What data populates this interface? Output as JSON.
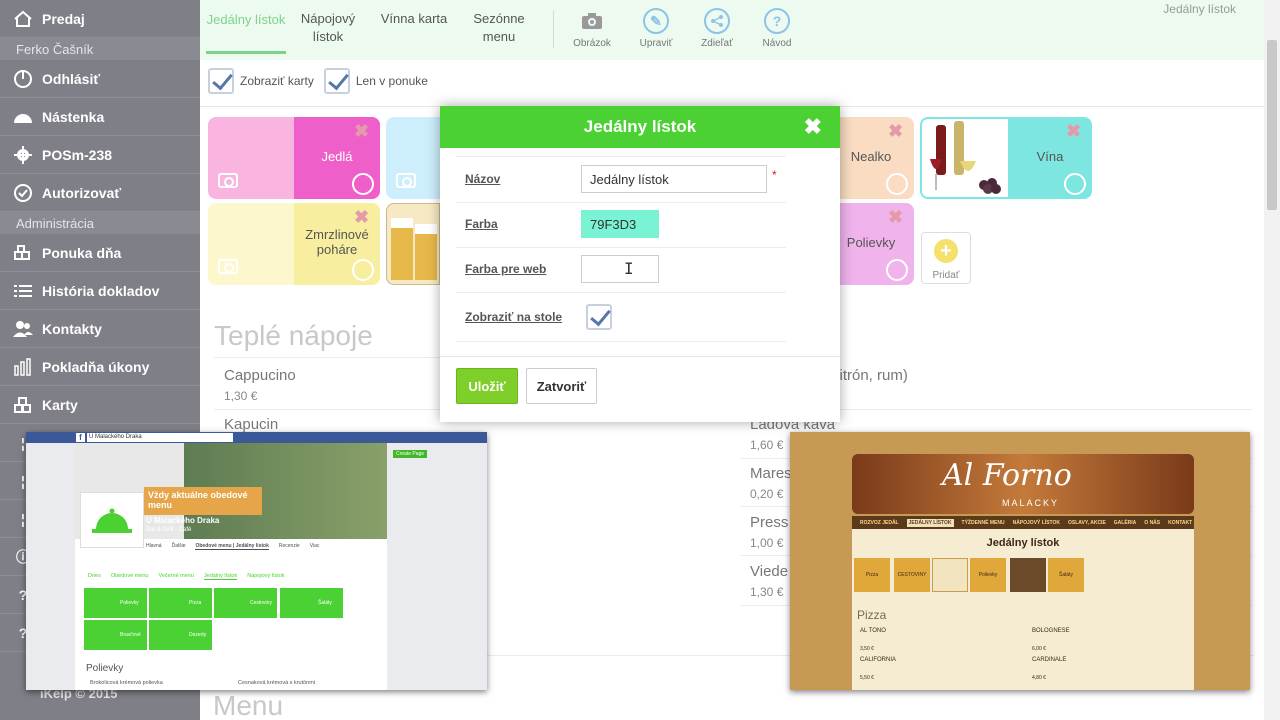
{
  "sidebar": {
    "items_top": [
      {
        "label": "Predaj",
        "icon": "home-icon"
      }
    ],
    "user_name": "Ferko Čašník",
    "items_user": [
      {
        "label": "Odhlásiť",
        "icon": "power-icon"
      },
      {
        "label": "Nástenka",
        "icon": "dashboard-icon"
      },
      {
        "label": "POSm-238",
        "icon": "gear-icon"
      },
      {
        "label": "Autorizovať",
        "icon": "check-circle-icon"
      }
    ],
    "section_admin": "Administrácia",
    "items_admin": [
      {
        "label": "Ponuka dňa",
        "icon": "star-blocks-icon"
      },
      {
        "label": "História dokladov",
        "icon": "list-icon"
      },
      {
        "label": "Kontakty",
        "icon": "people-icon"
      },
      {
        "label": "Pokladňa úkony",
        "icon": "bar-chart-icon"
      },
      {
        "label": "Karty",
        "icon": "blocks-icon"
      }
    ],
    "footer": "iKelp © 2015"
  },
  "topbar": {
    "tabs": [
      {
        "label": "Jedálny lístok"
      },
      {
        "label": "Nápojový lístok"
      },
      {
        "label": "Vínna karta"
      },
      {
        "label": "Sezónne menu"
      }
    ],
    "tools": [
      {
        "label": "Obrázok",
        "icon": "camera-icon"
      },
      {
        "label": "Upraviť",
        "icon": "pencil-icon"
      },
      {
        "label": "Zdieľať",
        "icon": "share-icon"
      },
      {
        "label": "Návod",
        "icon": "help-icon"
      }
    ],
    "right_title": "Jedálny lístok"
  },
  "checks": {
    "show_cards": "Zobraziť karty",
    "only_menu": "Len v ponuke"
  },
  "cards": {
    "jedla": "Jedlá",
    "zmrzlina": "Zmrzlinové poháre",
    "nealko": "Nealko",
    "vina": "Vína",
    "polievky": "Polievky",
    "pridat": "Pridať"
  },
  "section": {
    "title": "Teplé nápoje",
    "bottom_title": "Menu"
  },
  "items_left": [
    {
      "name": "Cappucino",
      "price": "1,30 €"
    },
    {
      "name": "Kapucin",
      "price": ""
    }
  ],
  "items_right": [
    {
      "name": "citrón, rum)",
      "price": ""
    },
    {
      "name": "Ľadová káva",
      "price": "1,60 €"
    },
    {
      "name": "Mares",
      "price": "0,20 €"
    },
    {
      "name": "Press",
      "price": "1,00 €"
    },
    {
      "name": "Viede",
      "price": "1,30 €"
    }
  ],
  "modal": {
    "title": "Jedálny lístok",
    "name_label": "Názov",
    "name_value": "Jedálny lístok",
    "color_label": "Farba",
    "color_value": "79F3D3",
    "webcolor_label": "Farba pre web",
    "webcolor_value": "",
    "show_label": "Zobraziť na stole",
    "save": "Uložiť",
    "close": "Zatvoriť",
    "required_mark": "*"
  },
  "fb": {
    "search": "U Malackého Draka",
    "create_page": "Create Page",
    "banner": "Vždy aktuálne obedové menu",
    "page_name": "U Malackého Draka",
    "page_sub": "Bar & Grill · Café",
    "nav": [
      "Hlavná",
      "Ďalšie",
      "Obedové menu | Jedálny lístok",
      "Recenzie",
      "Viac"
    ],
    "menu_tabs": [
      "Dnes",
      "Obedové menu",
      "Večerné menu",
      "Jedálny lístok",
      "Nápojový lístok"
    ],
    "tiles": [
      "Polievky",
      "Pizza",
      "Cestoviny",
      "Šaláty",
      "Bravčové",
      "Dezerty"
    ],
    "section": "Polievky",
    "soup1": "Brokolicová krémová polievka",
    "soup2": "Cesnaková krémová s krutónmi"
  },
  "web": {
    "logo": "Al Forno",
    "logo_sub": "MALACKY",
    "nav": [
      "ROZVOZ JEDÁL",
      "JEDÁLNY LÍSTOK",
      "TÝŽDENNÉ MENU",
      "NÁPOJOVÝ LÍSTOK",
      "OSLAVY, AKCIE",
      "GALÉRIA",
      "O NÁS",
      "KONTAKT"
    ],
    "title": "Jedálny lístok",
    "tiles": [
      "Pizza",
      "CESTOVINY",
      "Polievky",
      "Šaláty"
    ],
    "section": "Pizza",
    "pizzas": [
      {
        "name": "AL TONO",
        "price": "3,50 €"
      },
      {
        "name": "BOLOGNESE",
        "price": "6,00 €"
      },
      {
        "name": "CALIFORNIA",
        "price": "5,50 €"
      },
      {
        "name": "CARDINALE",
        "price": "4,80 €"
      }
    ]
  },
  "colors": {
    "accent_green": "#4bd133",
    "sidebar_bg": "#7f7f88",
    "swatch": "#79F3D3",
    "card_pink": "#f9b4df",
    "card_pink_dark": "#ef5fc9",
    "card_yellow": "#f7ef9f",
    "card_blue": "#cdeefc",
    "card_orange": "#f9dcc1",
    "card_teal": "#7ee6e0",
    "card_lilac": "#f0b3ec"
  }
}
